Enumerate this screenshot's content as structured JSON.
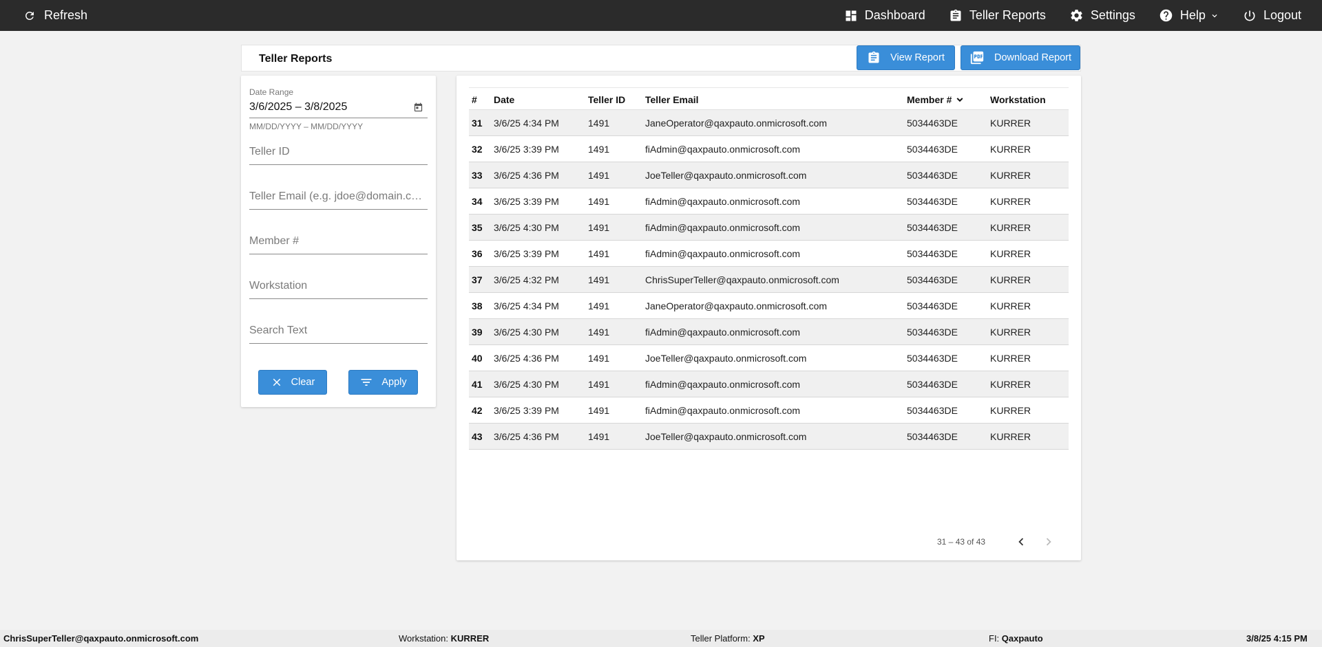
{
  "topbar": {
    "refresh_label": "Refresh",
    "nav": {
      "dashboard": "Dashboard",
      "teller_reports": "Teller Reports",
      "settings": "Settings",
      "help": "Help",
      "logout": "Logout"
    }
  },
  "header": {
    "title": "Teller Reports",
    "view_report_label": "View Report",
    "download_report_label": "Download Report"
  },
  "filters": {
    "date_range_label": "Date Range",
    "date_range_value": "3/6/2025 – 3/8/2025",
    "date_range_hint": "MM/DD/YYYY – MM/DD/YYYY",
    "teller_id_placeholder": "Teller ID",
    "teller_email_placeholder": "Teller Email (e.g. jdoe@domain.com)",
    "member_placeholder": "Member #",
    "workstation_placeholder": "Workstation",
    "search_placeholder": "Search Text",
    "clear_label": "Clear",
    "apply_label": "Apply"
  },
  "table": {
    "headers": {
      "num": "#",
      "date": "Date",
      "teller_id": "Teller ID",
      "teller_email": "Teller Email",
      "member": "Member #",
      "workstation": "Workstation"
    },
    "rows": [
      {
        "num": "31",
        "date": "3/6/25 4:34 PM",
        "teller_id": "1491",
        "email": "JaneOperator@qaxpauto.onmicrosoft.com",
        "member": "5034463DE",
        "workstation": "KURRER"
      },
      {
        "num": "32",
        "date": "3/6/25 3:39 PM",
        "teller_id": "1491",
        "email": "fiAdmin@qaxpauto.onmicrosoft.com",
        "member": "5034463DE",
        "workstation": "KURRER"
      },
      {
        "num": "33",
        "date": "3/6/25 4:36 PM",
        "teller_id": "1491",
        "email": "JoeTeller@qaxpauto.onmicrosoft.com",
        "member": "5034463DE",
        "workstation": "KURRER"
      },
      {
        "num": "34",
        "date": "3/6/25 3:39 PM",
        "teller_id": "1491",
        "email": "fiAdmin@qaxpauto.onmicrosoft.com",
        "member": "5034463DE",
        "workstation": "KURRER"
      },
      {
        "num": "35",
        "date": "3/6/25 4:30 PM",
        "teller_id": "1491",
        "email": "fiAdmin@qaxpauto.onmicrosoft.com",
        "member": "5034463DE",
        "workstation": "KURRER"
      },
      {
        "num": "36",
        "date": "3/6/25 3:39 PM",
        "teller_id": "1491",
        "email": "fiAdmin@qaxpauto.onmicrosoft.com",
        "member": "5034463DE",
        "workstation": "KURRER"
      },
      {
        "num": "37",
        "date": "3/6/25 4:32 PM",
        "teller_id": "1491",
        "email": "ChrisSuperTeller@qaxpauto.onmicrosoft.com",
        "member": "5034463DE",
        "workstation": "KURRER"
      },
      {
        "num": "38",
        "date": "3/6/25 4:34 PM",
        "teller_id": "1491",
        "email": "JaneOperator@qaxpauto.onmicrosoft.com",
        "member": "5034463DE",
        "workstation": "KURRER"
      },
      {
        "num": "39",
        "date": "3/6/25 4:30 PM",
        "teller_id": "1491",
        "email": "fiAdmin@qaxpauto.onmicrosoft.com",
        "member": "5034463DE",
        "workstation": "KURRER"
      },
      {
        "num": "40",
        "date": "3/6/25 4:36 PM",
        "teller_id": "1491",
        "email": "JoeTeller@qaxpauto.onmicrosoft.com",
        "member": "5034463DE",
        "workstation": "KURRER"
      },
      {
        "num": "41",
        "date": "3/6/25 4:30 PM",
        "teller_id": "1491",
        "email": "fiAdmin@qaxpauto.onmicrosoft.com",
        "member": "5034463DE",
        "workstation": "KURRER"
      },
      {
        "num": "42",
        "date": "3/6/25 3:39 PM",
        "teller_id": "1491",
        "email": "fiAdmin@qaxpauto.onmicrosoft.com",
        "member": "5034463DE",
        "workstation": "KURRER"
      },
      {
        "num": "43",
        "date": "3/6/25 4:36 PM",
        "teller_id": "1491",
        "email": "JoeTeller@qaxpauto.onmicrosoft.com",
        "member": "5034463DE",
        "workstation": "KURRER"
      }
    ],
    "pagination_range": "31 – 43 of 43"
  },
  "status_bar": {
    "user": "ChrisSuperTeller@qaxpauto.onmicrosoft.com",
    "workstation_label": "Workstation:",
    "workstation_value": "KURRER",
    "platform_label": "Teller Platform:",
    "platform_value": "XP",
    "fi_label": "FI:",
    "fi_value": "Qaxpauto",
    "datetime": "3/8/25 4:15 PM"
  },
  "colors": {
    "topbar_bg": "#2b2b2b",
    "accent_blue": "#3a8ed9",
    "page_bg": "#f2f2f2"
  }
}
